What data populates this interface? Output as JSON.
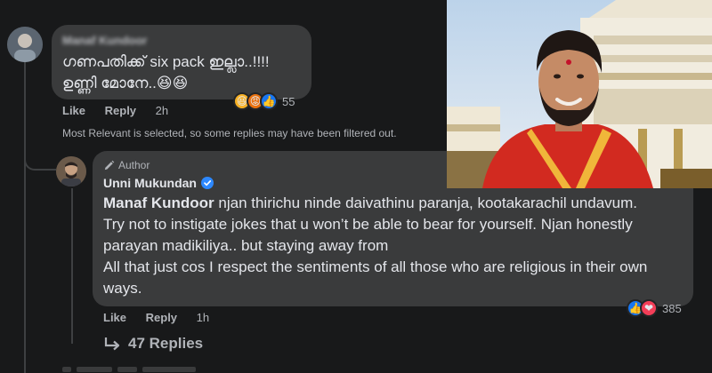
{
  "comment1": {
    "author": "Manaf Kundoor",
    "text_line1": "ഗണപതിക്ക് six pack ഇല്ലാ..!!!!",
    "text_line2": "ഉണ്ണി മോനേ..😆😆",
    "reaction_count": "55",
    "like_label": "Like",
    "reply_label": "Reply",
    "time": "2h"
  },
  "filter_note": "Most Relevant is selected, so some replies may have been filtered out.",
  "reply": {
    "badge": "Author",
    "author": "Unni Mukundan",
    "mention": "Manaf Kundoor",
    "text_line1": " njan thirichu ninde daivathinu paranja, kootakarachil undavum.",
    "text_line2": "Try not to instigate jokes that u won’t be able to bear for yourself. Njan honestly",
    "text_line3": "parayan madikiliya.. but staying away from",
    "text_line4": "All that just cos I respect the sentiments of all those who are religious in their own",
    "text_line5": "ways.",
    "reaction_count": "385",
    "like_label": "Like",
    "reply_label": "Reply",
    "time": "1h"
  },
  "replies_link": "47 Replies",
  "colors": {
    "background": "#18191a",
    "bubble": "#3a3b3c",
    "verified": "#2d88ff",
    "like_blue": "#1877f2",
    "love_red": "#f33e58"
  }
}
